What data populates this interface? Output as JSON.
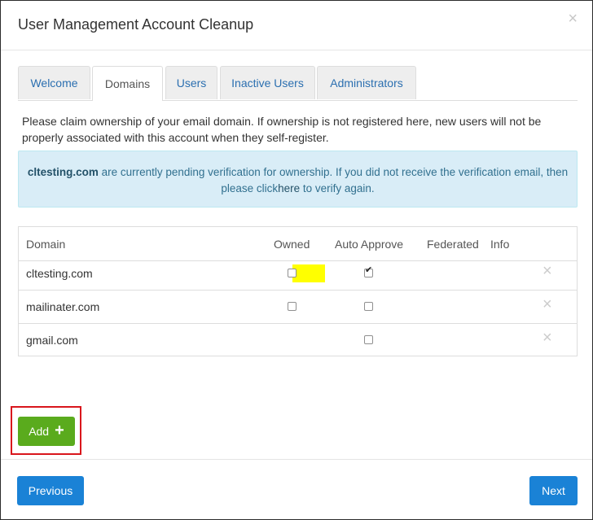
{
  "modal": {
    "title": "User Management Account Cleanup",
    "close_glyph": "×"
  },
  "tabs": [
    {
      "label": "Welcome",
      "active": false
    },
    {
      "label": "Domains",
      "active": true
    },
    {
      "label": "Users",
      "active": false
    },
    {
      "label": "Inactive Users",
      "active": false
    },
    {
      "label": "Administrators",
      "active": false
    }
  ],
  "intro": "Please claim ownership of your email domain. If ownership is not registered here, new users will not be properly associated with this account when they self-register.",
  "alert": {
    "domain": "cltesting.com",
    "text_before_link": " are currently pending verification for ownership. If you did not receive the verification email, then please click",
    "link_text": "here",
    "text_after_link": " to verify again."
  },
  "table": {
    "headers": {
      "domain": "Domain",
      "owned": "Owned",
      "auto_approve": "Auto Approve",
      "federated": "Federated",
      "info": "Info"
    },
    "rows": [
      {
        "domain": "cltesting.com",
        "owned": false,
        "owned_visible": true,
        "owned_highlighted": true,
        "auto_approve": true
      },
      {
        "domain": "mailinater.com",
        "owned": false,
        "owned_visible": true,
        "owned_highlighted": false,
        "auto_approve": false
      },
      {
        "domain": "gmail.com",
        "owned": false,
        "owned_visible": false,
        "owned_highlighted": false,
        "auto_approve": false
      }
    ],
    "remove_glyph": "×"
  },
  "add_button": {
    "label": "Add",
    "icon": "plus-icon",
    "icon_glyph": "+"
  },
  "footer": {
    "previous_label": "Previous",
    "next_label": "Next"
  },
  "colors": {
    "accent_blue": "#1a82d6",
    "add_green": "#5aab1d",
    "highlight_yellow": "#ffff00",
    "annotation_red": "#d9161c",
    "alert_bg": "#d9edf7"
  }
}
